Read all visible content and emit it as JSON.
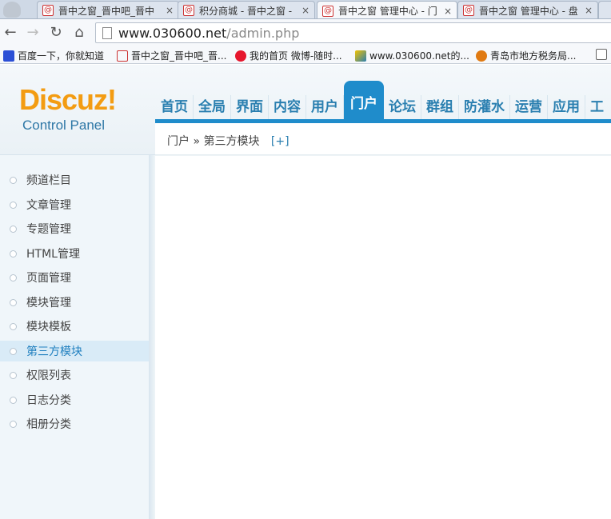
{
  "browser": {
    "tabs": [
      {
        "title": "晋中之窗_晋中吧_晋中",
        "close": "×",
        "active": false
      },
      {
        "title": "积分商城 - 晋中之窗 -",
        "close": "×",
        "active": false
      },
      {
        "title": "晋中之窗 管理中心 - 门",
        "close": "×",
        "active": true
      },
      {
        "title": "晋中之窗 管理中心 - 盘",
        "close": "×",
        "active": false
      }
    ],
    "url_host": "www.030600.net",
    "url_path": "/admin.php",
    "bookmarks": [
      {
        "label": "百度一下，你就知道",
        "icon": "baidu-icon"
      },
      {
        "label": "晋中之窗_晋中吧_晋...",
        "icon": "site-icon"
      },
      {
        "label": "我的首页 微博-随时...",
        "icon": "weibo-icon"
      },
      {
        "label": "www.030600.net的...",
        "icon": "chart-icon"
      },
      {
        "label": "青岛市地方税务局...",
        "icon": "tax-icon"
      }
    ]
  },
  "logo": {
    "main": "Discuz!",
    "sub": "Control Panel"
  },
  "topnav": [
    "首页",
    "全局",
    "界面",
    "内容",
    "用户",
    "门户",
    "论坛",
    "群组",
    "防灌水",
    "运营",
    "应用",
    "工"
  ],
  "topnav_active": "门户",
  "breadcrumb": {
    "path": "门户 » 第三方模块",
    "add": "[+]"
  },
  "sidebar": {
    "items": [
      "频道栏目",
      "文章管理",
      "专题管理",
      "HTML管理",
      "页面管理",
      "模块管理",
      "模块模板",
      "第三方模块",
      "权限列表",
      "日志分类",
      "相册分类"
    ],
    "active": "第三方模块"
  },
  "colors": {
    "accent": "#1f8ccb",
    "logo": "#f39c12",
    "sidebar_bg": "#f0f6fa"
  }
}
